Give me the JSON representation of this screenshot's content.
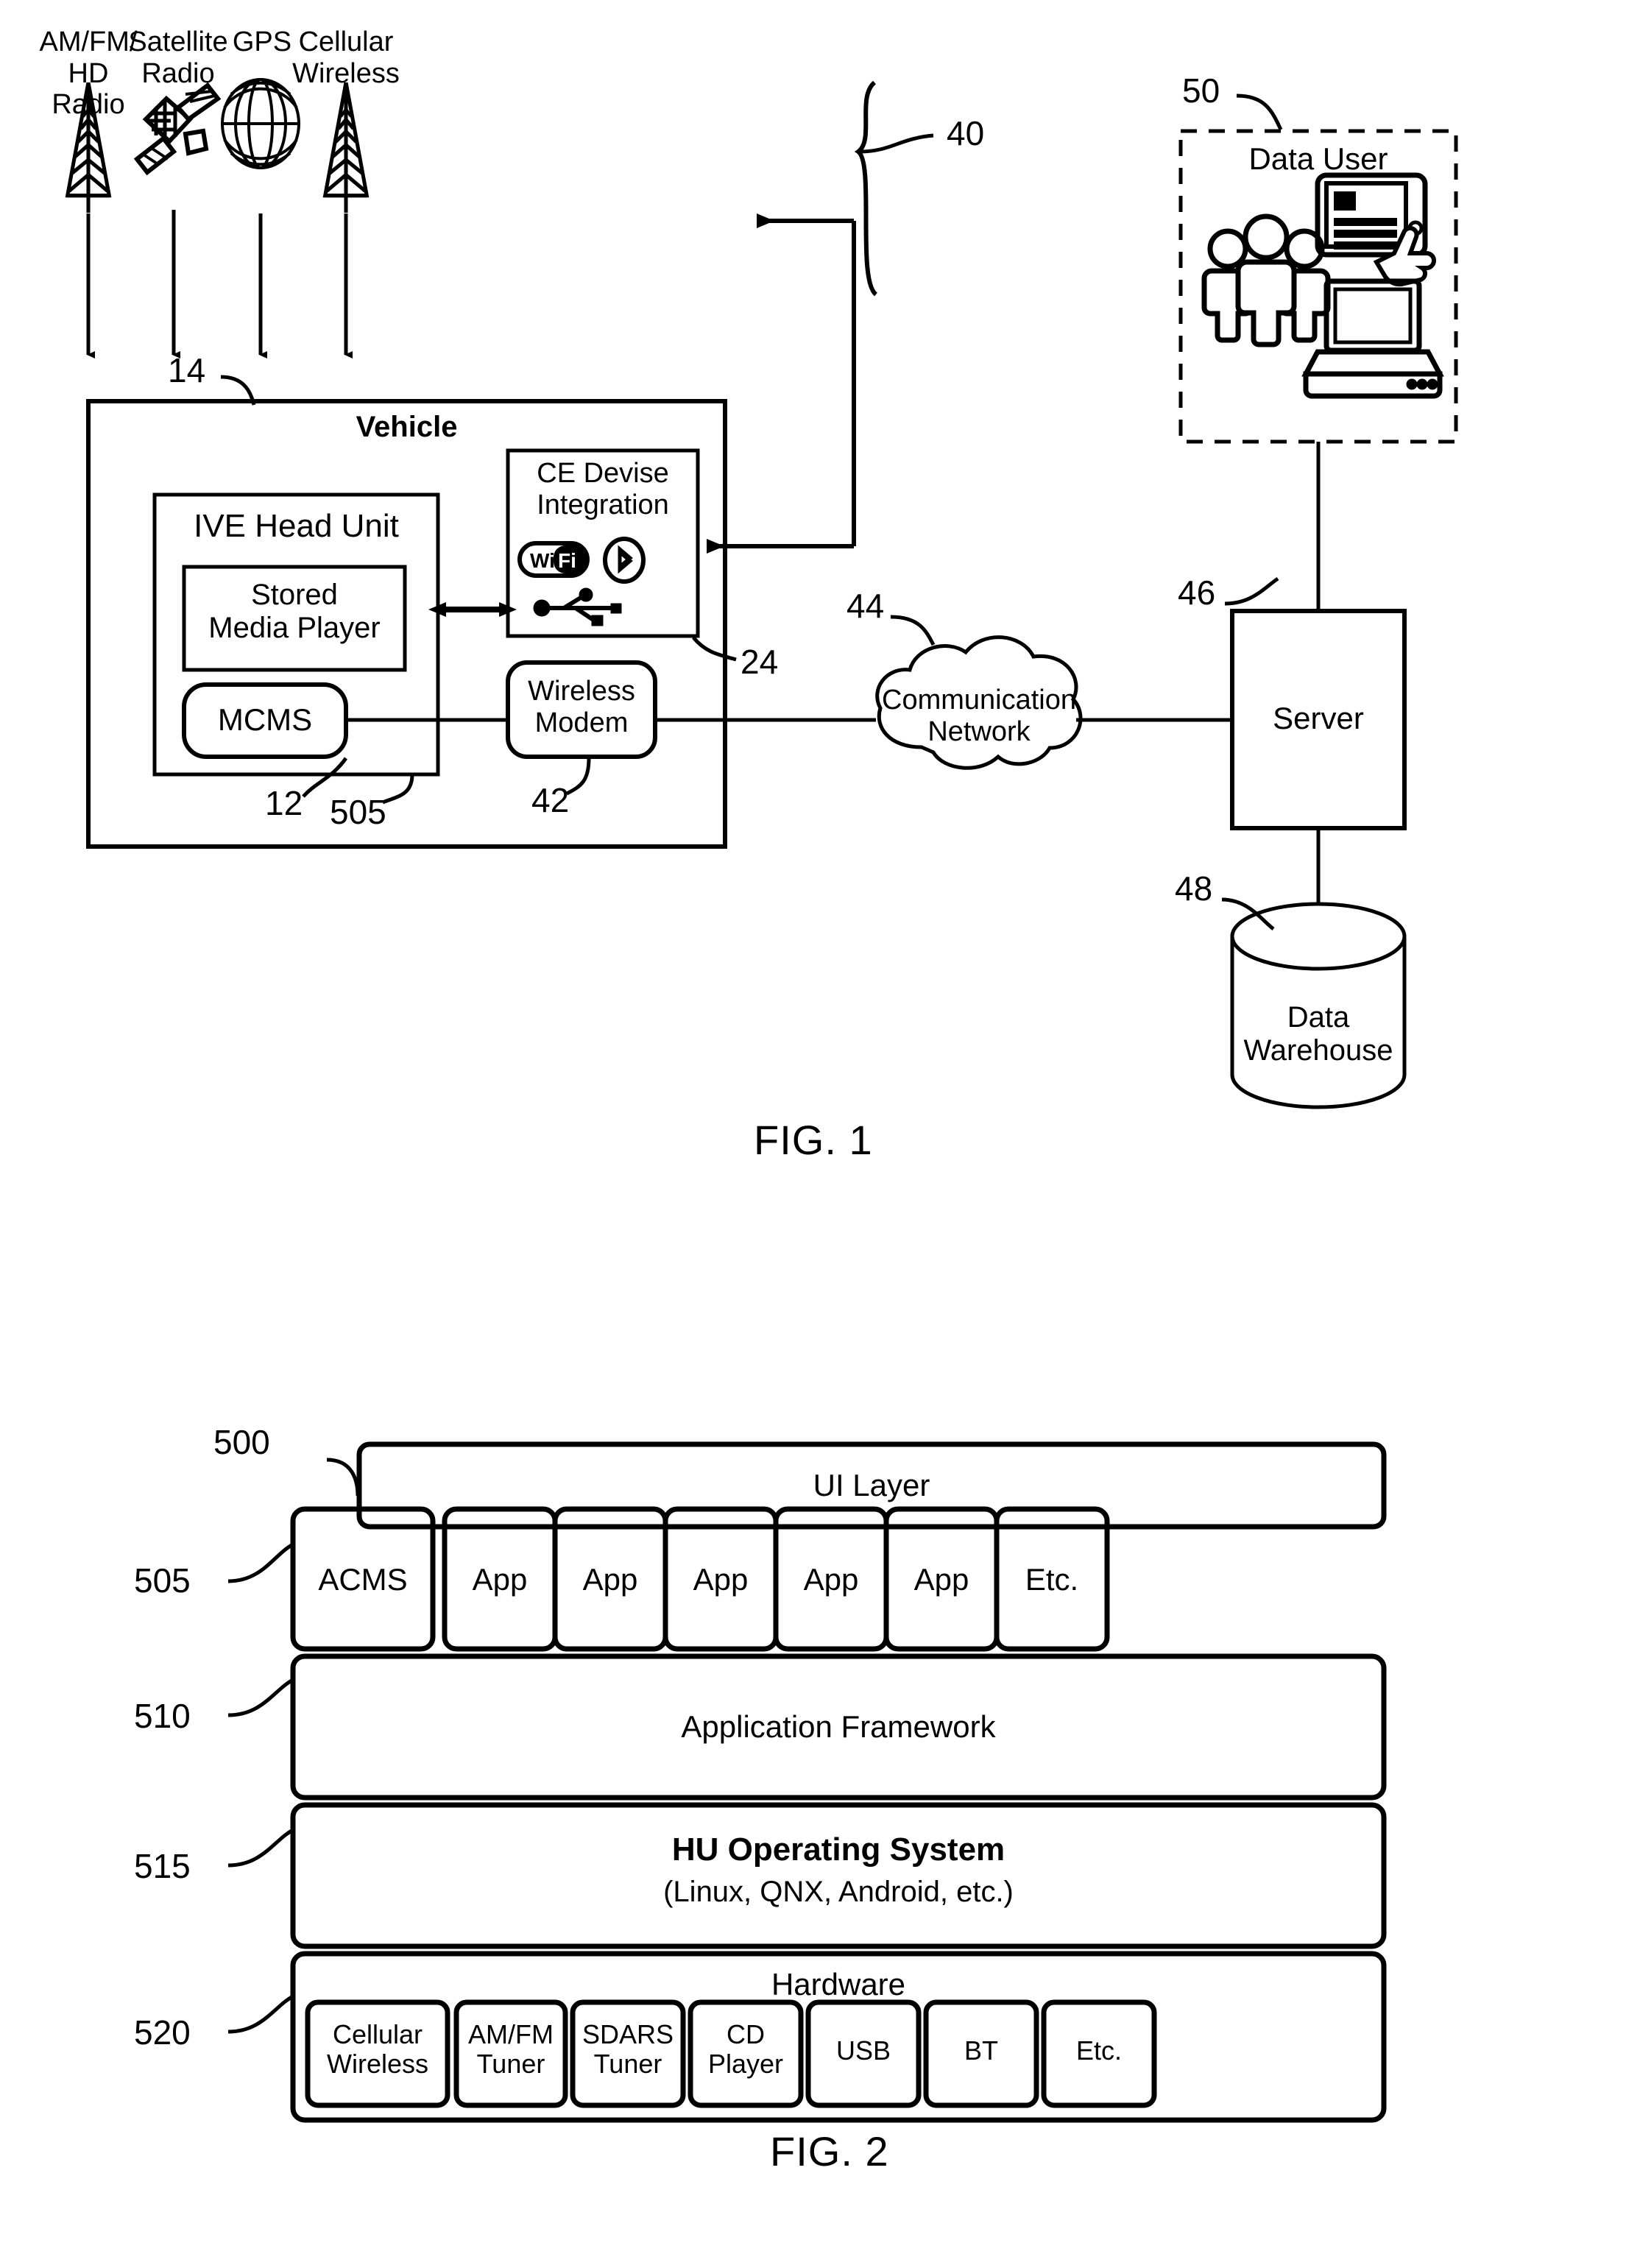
{
  "document": {
    "type": "patent-drawing-sheet",
    "figures": [
      "FIG. 1",
      "FIG. 2"
    ]
  },
  "fig1": {
    "caption": "FIG. 1",
    "sources": [
      {
        "label": "AM/FM/\nHD\nRadio",
        "icon": "antenna-tower-icon"
      },
      {
        "label": "Satellite\nRadio",
        "icon": "satellite-icon"
      },
      {
        "label": "GPS",
        "icon": "globe-icon"
      },
      {
        "label": "Cellular\nWireless",
        "icon": "antenna-tower-icon"
      }
    ],
    "refs": {
      "brace_40": "40",
      "vehicle_14": "14",
      "head_unit_12": "12",
      "mcms_505": "505",
      "ce_device_24": "24",
      "wireless_modem_42": "42",
      "network_44": "44",
      "server_46": "46",
      "warehouse_48": "48",
      "data_user_50": "50"
    },
    "vehicle": {
      "title": "Vehicle",
      "head_unit": {
        "title": "IVE Head Unit",
        "stored_media_player": "Stored\nMedia Player",
        "mcms": "MCMS"
      },
      "ce_device": {
        "title": "CE Devise\nIntegration",
        "icons": [
          "wifi-icon",
          "bluetooth-icon",
          "usb-icon"
        ]
      },
      "wireless_modem": "Wireless\nModem"
    },
    "network": "Communication\nNetwork",
    "server": "Server",
    "data_warehouse": "Data\nWarehouse",
    "data_user": {
      "title": "Data User",
      "icons": [
        "people-group-icon",
        "tablet-touch-icon",
        "laptop-icon"
      ]
    }
  },
  "fig2": {
    "caption": "FIG. 2",
    "refs": {
      "ui_layer": "500",
      "apps_row": "505",
      "application_framework": "510",
      "hu_operating_system": "515",
      "hardware": "520"
    },
    "ui_layer": "UI Layer",
    "apps": [
      "ACMS",
      "App",
      "App",
      "App",
      "App",
      "App",
      "Etc."
    ],
    "application_framework": "Application Framework",
    "os": {
      "title": "HU Operating System",
      "subtitle": "(Linux, QNX, Android, etc.)"
    },
    "hardware": {
      "title": "Hardware",
      "items": [
        "Cellular\nWireless",
        "AM/FM\nTuner",
        "SDARS\nTuner",
        "CD\nPlayer",
        "USB",
        "BT",
        "Etc."
      ]
    }
  },
  "style": {
    "ink": "#000000",
    "paper": "#ffffff"
  }
}
